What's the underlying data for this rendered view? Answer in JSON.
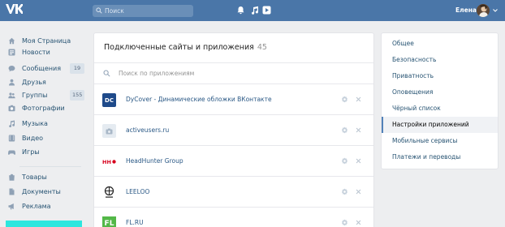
{
  "header": {
    "logo_text": "VK",
    "search_placeholder": "Поиск",
    "icons": [
      "bell-icon",
      "music-icon",
      "play-icon"
    ],
    "user_name": "Елена"
  },
  "left_menu": {
    "items": [
      {
        "label": "Моя Страница",
        "icon": "home-icon"
      },
      {
        "label": "Новости",
        "icon": "news-icon"
      },
      {
        "label": "Сообщения",
        "icon": "messages-icon",
        "count": "19"
      },
      {
        "label": "Друзья",
        "icon": "friends-icon"
      },
      {
        "label": "Группы",
        "icon": "groups-icon",
        "count": "155"
      },
      {
        "label": "Фотографии",
        "icon": "photos-icon"
      },
      {
        "label": "Музыка",
        "icon": "music-icon"
      },
      {
        "label": "Видео",
        "icon": "video-icon"
      },
      {
        "label": "Игры",
        "icon": "games-icon"
      },
      {
        "label": "Товары",
        "icon": "goods-icon"
      },
      {
        "label": "Документы",
        "icon": "documents-icon"
      },
      {
        "label": "Реклама",
        "icon": "ads-icon"
      }
    ]
  },
  "main": {
    "title": "Подключенные сайты и приложения",
    "count": "45",
    "search_placeholder": "Поиск по приложениям",
    "apps": [
      {
        "name": "DyCover - Динамические обложки ВКонтакте",
        "icon_text": "DC",
        "icon_bg": "#1f4a8a",
        "icon_color": "#ffffff"
      },
      {
        "name": "activeusers.ru",
        "icon_text": "",
        "icon_bg": "#e5ebf1",
        "icon_color": "#8a9bb0"
      },
      {
        "name": "HeadHunter Group",
        "icon_text": "HH",
        "icon_bg": "#ffffff",
        "icon_color": "#d6001c"
      },
      {
        "name": "LEELOO",
        "icon_text": "",
        "icon_bg": "#ffffff",
        "icon_color": "#222222"
      },
      {
        "name": "FL.RU",
        "icon_text": "FL",
        "icon_bg": "#53b848",
        "icon_color": "#ffffff"
      }
    ]
  },
  "right_menu": {
    "items": [
      {
        "label": "Общее",
        "active": false
      },
      {
        "label": "Безопасность",
        "active": false
      },
      {
        "label": "Приватность",
        "active": false
      },
      {
        "label": "Оповещения",
        "active": false
      },
      {
        "label": "Чёрный список",
        "active": false
      },
      {
        "label": "Настройки приложений",
        "active": true
      },
      {
        "label": "Мобильные сервисы",
        "active": false
      },
      {
        "label": "Платежи и переводы",
        "active": false
      }
    ]
  },
  "colors": {
    "header": "#4a76a8",
    "link": "#2a5885",
    "active_border": "#5181b8",
    "page_bg": "#edeef0"
  }
}
